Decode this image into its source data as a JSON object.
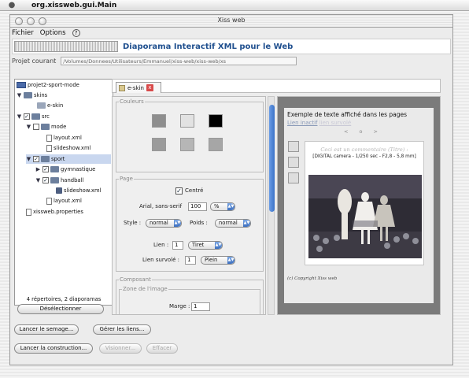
{
  "os_menubar": {
    "app_title": "org.xissweb.gui.Main"
  },
  "window": {
    "title": "Xiss web"
  },
  "app_menu": {
    "items": [
      "Fichier",
      "Options"
    ],
    "help": "?"
  },
  "header": {
    "title": "Diaporama Interactif XML pour le Web"
  },
  "project": {
    "label": "Projet courant",
    "path": "/Volumes/Donnees/Utilisateurs/Emmanuel/xiss-web/xiss-web/xs"
  },
  "tree": {
    "root": "projet2-sport-mode",
    "skins": "skins",
    "eskin": "e-skin",
    "src": "src",
    "mode": "mode",
    "mode_layout": "layout.xml",
    "mode_slideshow": "slideshow.xml",
    "sport": "sport",
    "gymnastique": "gymnastique",
    "handball": "handball",
    "handball_slideshow": "slideshow.xml",
    "sport_layout": "layout.xml",
    "props": "xissweb.properties",
    "status": "4 répertoires, 2 diaporamas",
    "deselect": "Désélectionner"
  },
  "tab": {
    "label": "e-skin",
    "close": "x"
  },
  "couleurs": {
    "legend": "Couleurs",
    "swatches": [
      "#8e8e8e",
      "#e2e2e2",
      "#000000",
      "#9b9b9b",
      "#b6b6b6",
      "#a6a6a6"
    ]
  },
  "page_section": {
    "legend": "Page",
    "centre_label": "Centré",
    "centre_checked": true,
    "font": "Arial, sans-serif",
    "size_value": "100",
    "size_unit": "%",
    "style_label": "Style :",
    "style_value": "normal",
    "poids_label": "Poids :",
    "poids_value": "normal",
    "lien_label": "Lien :",
    "lien_value": "1",
    "lien_style": "Tiret",
    "survole_label": "Lien survolé :",
    "survole_value": "1",
    "survole_style": "Plein"
  },
  "composant": {
    "legend": "Composant",
    "zone_legend": "Zone de l'image",
    "marge_label": "Marge :",
    "marge_value": "1"
  },
  "preview": {
    "title": "Exemple de texte affiché dans les pages",
    "link_inactive": "Lien inactif",
    "link_hover": "lien survolé",
    "nav": "< o >",
    "caption_title": "Ceci est un commentaire (Titre) :",
    "caption_exif": "[DIGITAL camera - 1/250 sec - F2,8 - 5,8 mm]",
    "copyright": "(c) Copyright Xiss web"
  },
  "buttons": {
    "semage": "Lancer le semage...",
    "liens": "Gérer les liens...",
    "construction": "Lancer la construction...",
    "visionner": "Visionner...",
    "effacer": "Effacer"
  },
  "colors": {
    "accent": "#3a72c8",
    "header_title": "#20508f",
    "close_tab": "#d84a4a"
  }
}
